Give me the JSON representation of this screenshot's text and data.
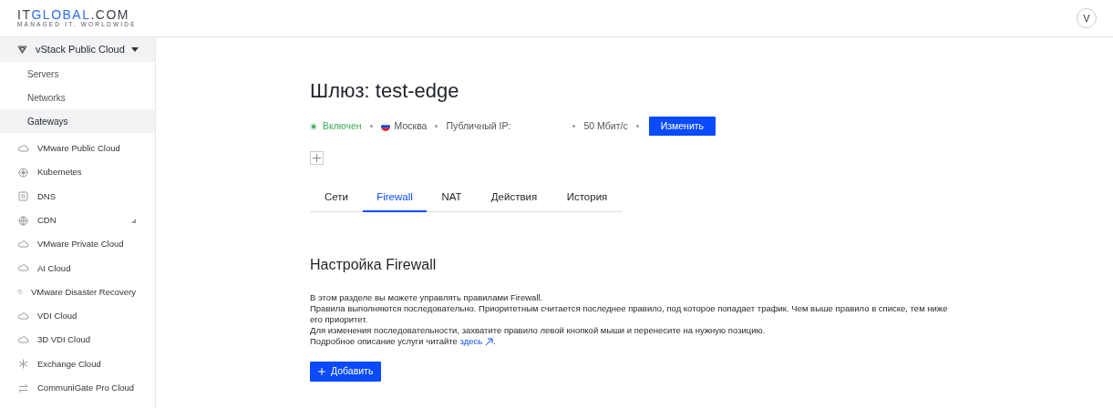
{
  "logo": {
    "part_1": "IT",
    "part_2": "GLOBAL",
    "part_3": ".COM",
    "tagline": "MANAGED IT. WORLDWIDE"
  },
  "user": {
    "initial": "V"
  },
  "sidebar": {
    "group": {
      "label": "vStack Public Cloud",
      "expanded": true,
      "children": [
        {
          "label": "Servers",
          "selected": false
        },
        {
          "label": "Networks",
          "selected": false
        },
        {
          "label": "Gateways",
          "selected": true
        }
      ]
    },
    "items": [
      {
        "label": "VMware Public Cloud",
        "kind": "cloud"
      },
      {
        "label": "Kubernetes",
        "kind": "wheel"
      },
      {
        "label": "DNS",
        "kind": "square"
      },
      {
        "label": "CDN",
        "kind": "globe",
        "expanded": false
      },
      {
        "label": "VMware Private Cloud",
        "kind": "cloud"
      },
      {
        "label": "AI Cloud",
        "kind": "cloud"
      },
      {
        "label": "VMware Disaster Recovery",
        "kind": "copy"
      },
      {
        "label": "VDI Cloud",
        "kind": "cloud"
      },
      {
        "label": "3D VDI Cloud",
        "kind": "cloud"
      },
      {
        "label": "Exchange Cloud",
        "kind": "snowflake"
      },
      {
        "label": "CommuniGate Pro Cloud",
        "kind": "arrows"
      }
    ]
  },
  "title": "Шлюз: test-edge",
  "status": {
    "label": "Включен",
    "on": true
  },
  "location": "Москва",
  "public_ip_label": "Публичный IP:",
  "speed": "50 Мбит/с",
  "edit_button": "Изменить",
  "tabs": [
    {
      "label": "Сети",
      "selected": false
    },
    {
      "label": "Firewall",
      "selected": true
    },
    {
      "label": "NAT",
      "selected": false
    },
    {
      "label": "Действия",
      "selected": false
    },
    {
      "label": "История",
      "selected": false
    }
  ],
  "section_title": "Настройка Firewall",
  "description": [
    "В этом разделе вы можете управлять правилами Firewall.",
    "Правила выполняются последовательно. Приоритетным считается последнее правило, под которое попадает трафик. Чем выше правило в списке, тем ниже его приоритет.",
    "Для изменения последовательности, захватите правило левой кнопкой мыши и перенесите на нужную позицию."
  ],
  "more_info": {
    "text": "Подробное описание услуги читайте ",
    "link": "здесь",
    "after": "."
  },
  "add_button": "Добавить"
}
